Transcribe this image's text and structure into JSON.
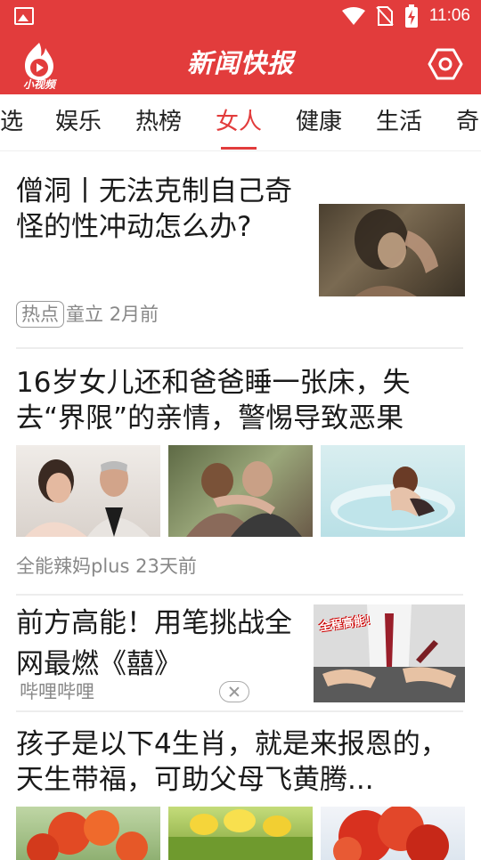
{
  "status_bar": {
    "time": "11:06",
    "icons": [
      "gallery-icon",
      "wifi-icon",
      "no-sim-icon",
      "battery-charging-icon"
    ]
  },
  "app_bar": {
    "logo_text": "小视频",
    "title": "新闻快报",
    "settings_icon": "hexagon-settings-icon"
  },
  "tabs": {
    "items": [
      {
        "label": "选",
        "active": false
      },
      {
        "label": "娱乐",
        "active": false
      },
      {
        "label": "热榜",
        "active": false
      },
      {
        "label": "女人",
        "active": true
      },
      {
        "label": "健康",
        "active": false
      },
      {
        "label": "生活",
        "active": false
      },
      {
        "label": "奇",
        "active": false
      }
    ]
  },
  "feed": [
    {
      "headline": "僧洞丨无法克制自己奇怪的性冲动怎么办?",
      "tag": "热点",
      "source": "童立",
      "time": "2月前"
    },
    {
      "headline": "16岁女儿还和爸爸睡一张床，失去“界限”的亲情，警惕导致恶果",
      "source": "全能辣妈plus",
      "time": "23天前"
    },
    {
      "headline": "前方高能！用笔挑战全网最燃《囍》",
      "source": "哔哩哔哩",
      "ad_overlay_text": "全程高能！"
    },
    {
      "headline": "孩子是以下4生肖，就是来报恩的，天生带福，可助父母飞黄腾..."
    }
  ],
  "colors": {
    "brand_red": "#e23c3c",
    "active_tab": "#e23c3c",
    "meta_gray": "#888888"
  }
}
